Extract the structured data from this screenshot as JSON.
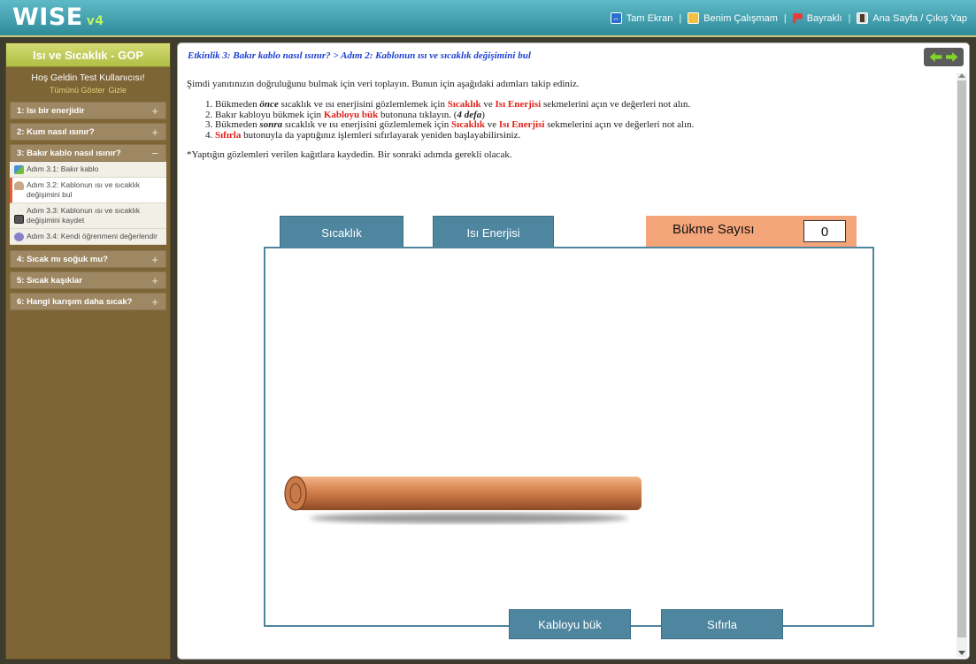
{
  "header": {
    "logo": "WISE",
    "version": "v4",
    "nav": {
      "full_screen": "Tam Ekran",
      "my_work": "Benim Çalışmam",
      "flagged": "Bayraklı",
      "home_exit": "Ana Sayfa / Çıkış Yap"
    }
  },
  "sidebar": {
    "title": "Isı ve Sıcaklık - GOP",
    "welcome": "Hoş Geldin Test Kullanıcısı!",
    "show_all": "Tümünü Göster",
    "hide": "Gizle",
    "activities": [
      {
        "label": "1: Isı bir enerjidir",
        "toggle": "+"
      },
      {
        "label": "2: Kum nasıl ısınır?",
        "toggle": "+"
      },
      {
        "label": "3: Bakır kablo nasıl ısınır?",
        "toggle": "−"
      },
      {
        "label": "4: Sıcak mı soğuk mu?",
        "toggle": "+"
      },
      {
        "label": "5: Sıcak kaşıklar",
        "toggle": "+"
      },
      {
        "label": "6: Hangi karışım daha sıcak?",
        "toggle": "+"
      }
    ],
    "steps": [
      {
        "label": "Adım 3.1: Bakır kablo",
        "icon": "graph-icon"
      },
      {
        "label": "Adım 3.2: Kablonun ısı ve sıcaklık değişimini bul",
        "icon": "person-icon"
      },
      {
        "label": "Adım 3.3: Kablonun ısı ve sıcaklık değişimini kaydet",
        "icon": "note-icon"
      },
      {
        "label": "Adım 3.4: Kendi öğrenmeni değerlendir",
        "icon": "people-icon"
      }
    ]
  },
  "main": {
    "breadcrumb": "Etkinlik 3: Bakır kablo nasıl ısınır? > Adım 2: Kablonun ısı ve sıcaklık değişimini bul",
    "intro": "Şimdi yanıtınızın doğruluğunu bulmak için veri toplayın. Bunun için aşağıdaki adımları takip ediniz.",
    "steps": {
      "s1a": "1. Bükmeden ",
      "s1b": "önce",
      "s1c": " sıcaklık ve ısı enerjisini gözlemlemek için ",
      "s1d": "Sıcaklık",
      "s1e": " ve ",
      "s1f": "Isı Enerjisi",
      "s1g": " sekmelerini açın ve değerleri not alın.",
      "s2a": "2. Bakır kabloyu bükmek için ",
      "s2b": "Kabloyu bük",
      "s2c": " butonuna tıklayın. (",
      "s2d": "4 defa",
      "s2e": ")",
      "s3a": "3. Bükmeden ",
      "s3b": "sonra",
      "s3c": " sıcaklık ve ısı enerjisini gözlemlemek için ",
      "s3d": "Sıcaklık",
      "s3e": " ve ",
      "s3f": "Isı Enerjisi",
      "s3g": " sekmelerini açın ve değerleri not alın.",
      "s4a": "4. ",
      "s4b": "Sıfırla",
      "s4c": " butonuyla da yaptığınız işlemleri sıfırlayarak yeniden başlayabilirsiniz."
    },
    "note": "*Yaptığın gözlemleri verilen kağıtlara kaydedin. Bir sonraki adımda gerekli olacak."
  },
  "simulation": {
    "tab_temperature": "Sıcaklık",
    "tab_heat": "Isı Enerjisi",
    "bend_count_label": "Bükme Sayısı",
    "bend_count": "0",
    "bend_button": "Kabloyu bük",
    "reset_button": "Sıfırla"
  },
  "colors": {
    "accent_teal": "#4e86a0",
    "highlight_red": "#e0221b",
    "breadcrumb_blue": "#1c3fd4",
    "counter_bg": "#f5a57a",
    "sidebar_bg": "#7d6535",
    "wire_copper": "#d98a55"
  }
}
